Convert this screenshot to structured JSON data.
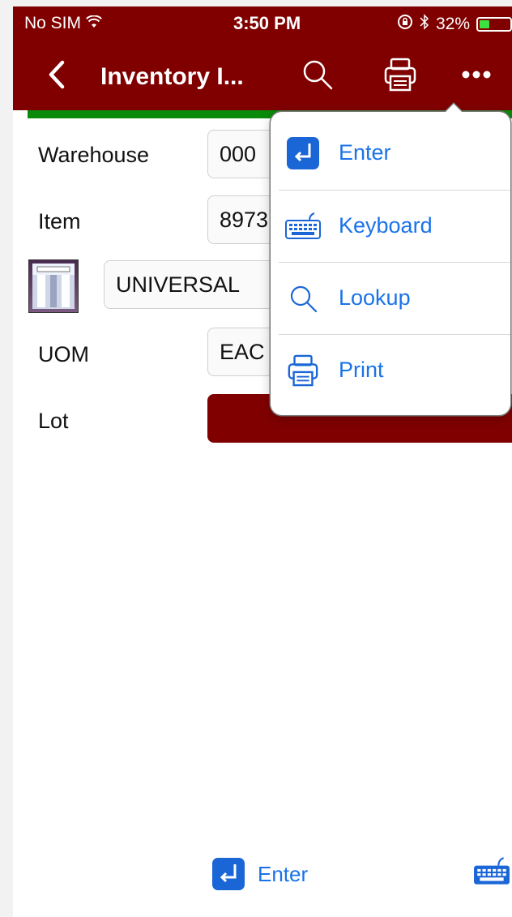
{
  "status_bar": {
    "carrier": "No SIM",
    "time": "3:50 PM",
    "battery_percent": "32%",
    "battery_level": 0.32
  },
  "nav": {
    "title": "Inventory I...",
    "back_icon": "chevron-left-icon",
    "search_icon": "search-icon",
    "print_icon": "printer-icon",
    "more_icon": "ellipsis-icon"
  },
  "form": {
    "warehouse": {
      "label": "Warehouse",
      "value": "000"
    },
    "item": {
      "label": "Item",
      "value": "8973"
    },
    "description": {
      "value": "UNIVERSAL"
    },
    "uom": {
      "label": "UOM",
      "value": "EAC"
    },
    "lot": {
      "label": "Lot",
      "value": ""
    }
  },
  "menu": {
    "items": [
      {
        "label": "Enter",
        "icon": "enter-icon"
      },
      {
        "label": "Keyboard",
        "icon": "keyboard-icon"
      },
      {
        "label": "Lookup",
        "icon": "search-icon"
      },
      {
        "label": "Print",
        "icon": "printer-icon"
      }
    ]
  },
  "toolbar": {
    "enter_label": "Enter",
    "keyboard_icon": "keyboard-icon"
  },
  "colors": {
    "brand": "#800000",
    "accent": "#1a73e8",
    "status_green": "#0a8a0a"
  }
}
